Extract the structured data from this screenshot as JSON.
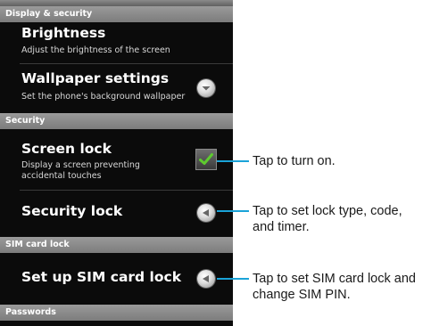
{
  "sections": {
    "display_security": "Display & security",
    "security": "Security",
    "sim_card_lock": "SIM card lock",
    "passwords": "Passwords"
  },
  "items": {
    "brightness": {
      "title": "Brightness",
      "subtitle": "Adjust the brightness of the screen"
    },
    "wallpaper": {
      "title": "Wallpaper settings",
      "subtitle": "Set the phone's background wallpaper"
    },
    "screen_lock": {
      "title": "Screen lock",
      "subtitle": "Display a screen preventing accidental touches",
      "checked": true
    },
    "security_lock": {
      "title": "Security lock"
    },
    "sim_lock": {
      "title": "Set up SIM card lock"
    }
  },
  "callouts": {
    "screen_lock": "Tap to turn on.",
    "security_lock": [
      "Tap to set lock type, code,",
      "and timer."
    ],
    "sim_lock": [
      "Tap to set SIM card lock and",
      "change SIM PIN."
    ]
  },
  "colors": {
    "accent_line": "#1aa3d8",
    "check_green": "#5ecb2e"
  },
  "icons": {
    "chevron": "chevron-down-icon",
    "arrow": "arrow-icon",
    "check": "check-icon"
  }
}
